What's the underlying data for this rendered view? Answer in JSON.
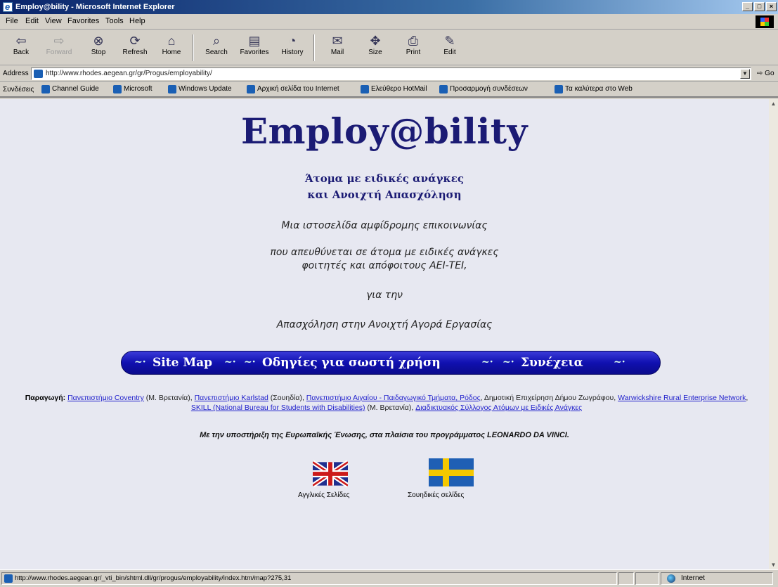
{
  "window": {
    "title": "Employ@bility - Microsoft Internet Explorer",
    "controls": [
      "_",
      "□",
      "×"
    ]
  },
  "menu": [
    "File",
    "Edit",
    "View",
    "Favorites",
    "Tools",
    "Help"
  ],
  "toolbar": [
    {
      "label": "Back",
      "icon": "back-arrow-icon"
    },
    {
      "label": "Forward",
      "icon": "forward-arrow-icon",
      "disabled": true
    },
    {
      "label": "Stop",
      "icon": "stop-icon"
    },
    {
      "label": "Refresh",
      "icon": "refresh-icon"
    },
    {
      "label": "Home",
      "icon": "home-icon"
    },
    {
      "label": "Search",
      "icon": "search-icon"
    },
    {
      "label": "Favorites",
      "icon": "favorites-icon"
    },
    {
      "label": "History",
      "icon": "history-icon"
    },
    {
      "label": "Mail",
      "icon": "mail-icon"
    },
    {
      "label": "Size",
      "icon": "size-icon"
    },
    {
      "label": "Print",
      "icon": "print-icon"
    },
    {
      "label": "Edit",
      "icon": "edit-icon"
    }
  ],
  "address": {
    "label": "Address",
    "url": "http://www.rhodes.aegean.gr/gr/Progus/employability/",
    "go": "Go"
  },
  "links": {
    "label": "Συνδέσεις",
    "items": [
      "Channel Guide",
      "Microsoft",
      "Windows Update",
      "Αρχική σελίδα του Internet",
      "Ελεύθερο HotMail",
      "Προσαρμογή συνδέσεων",
      "Τα καλύτερα στο Web"
    ]
  },
  "page": {
    "title": "Employ@bility",
    "subtitle1": "Άτομα με ειδικές ανάγκες",
    "subtitle2": "και Ανοιχτή Απασχόληση",
    "tagline1": "Μια ιστοσελίδα αμφίδρομης επικοινωνίας",
    "tagline2": "που απευθύνεται σε άτομα με ειδικές ανάγκες",
    "tagline3": "φοιτητές και απόφοιτους ΑΕΙ-ΤΕΙ,",
    "tagline4": "για την",
    "tagline5": "Απασχόληση στην Ανοιχτή Αγορά Εργασίας",
    "nav": {
      "site_map": "Site Map",
      "instructions": "Οδηγίες για σωστή χρήση",
      "continue": "Συνέχεια",
      "ornament": "~·"
    },
    "credits": {
      "label": "Παραγωγή:",
      "link1": "Πανεπιστήμιο Coventry",
      "text1": " (Μ. Βρετανία), ",
      "link2": "Πανεπιστήμιο Karlstad",
      "text2": " (Σουηδία), ",
      "link3": "Πανεπιστήμιο Αιγαίου - Παιδαγωγικό Τμήματα, Ρόδος",
      "text3": ", Δημοτική Επιχείρηση Δήμου Ζωγράφου, ",
      "link4": "Warwickshire Rural Enterprise Network",
      "text4": ", ",
      "link5": "SKILL (National Bureau for Students with Disabilities)",
      "text5": " (Μ. Βρετανία), ",
      "link6": "Διαδικτυακός Σύλλογος Ατόμων με Ειδικές Ανάγκες"
    },
    "support": "Με την υποστήριξη της Ευρωπαϊκής Ένωσης, στα πλαίσια του προγράμματος LEONARDO DA VINCI.",
    "flags": [
      {
        "label": "Αγγλικές Σελίδες",
        "icon": "uk-flag-icon"
      },
      {
        "label": "Σουηδικές σελίδες",
        "icon": "sweden-flag-icon"
      }
    ]
  },
  "status": {
    "text": "http://www.rhodes.aegean.gr/_vti_bin/shtml.dll/gr/progus/employability/index.htm/map?275,31",
    "zone": "Internet"
  }
}
